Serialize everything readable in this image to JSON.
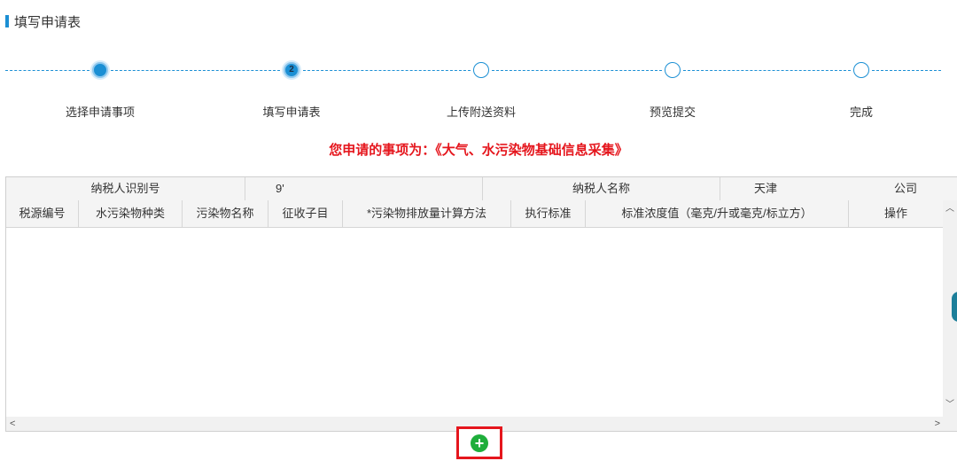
{
  "section": {
    "title": "填写申请表"
  },
  "steps": [
    {
      "label": "选择申请事项",
      "status": "done",
      "number": ""
    },
    {
      "label": "填写申请表",
      "status": "active",
      "number": "2"
    },
    {
      "label": "上传附送资料",
      "status": "todo",
      "number": ""
    },
    {
      "label": "预览提交",
      "status": "todo",
      "number": ""
    },
    {
      "label": "完成",
      "status": "todo",
      "number": ""
    }
  ],
  "apply_title": "您申请的事项为：《大气、水污染物基础信息采集》",
  "taxpayer": {
    "id_label": "纳税人识别号",
    "id_value": "9'",
    "name_label": "纳税人名称",
    "name_value_prefix": "天津",
    "name_value_suffix": "公司"
  },
  "table": {
    "columns": [
      "税源编号",
      "水污染物种类",
      "污染物名称",
      "征收子目",
      "*污染物排放量计算方法",
      "执行标准",
      "标准浓度值（毫克/升或毫克/标立方）",
      "操作"
    ],
    "rows": []
  },
  "add_button": {
    "symbol": "+"
  },
  "colors": {
    "accent": "#1b8fd4",
    "highlight_red": "#e5161d",
    "add_green": "#1fae3b"
  }
}
